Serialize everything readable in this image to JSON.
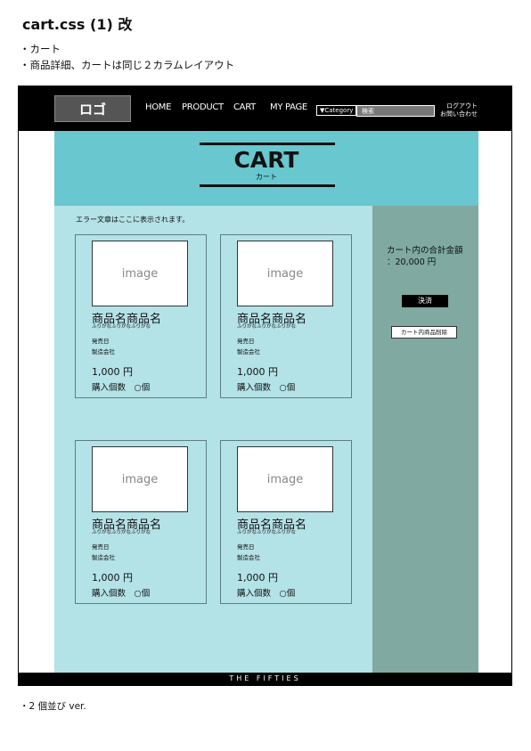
{
  "document": {
    "title": "cart.css (1) 改",
    "notes": [
      "・カート",
      "・商品詳細、カートは同じ２カラムレイアウト"
    ],
    "footnote": "・2 個並び ver."
  },
  "header": {
    "logo": "ロゴ",
    "nav": [
      "HOME",
      "PRODUCT",
      "CART",
      "MY PAGE"
    ],
    "category": "▼Category",
    "search_placeholder": "検索",
    "logout": "ログアウト",
    "contact": "お問い合わせ"
  },
  "hero": {
    "title": "CART",
    "subtitle": "カート"
  },
  "error_message": "エラー文章はここに表示されます。",
  "products": [
    {
      "image": "image",
      "name": "商品名商品名",
      "kana": "ふりがなふりがなふりがな",
      "release": "発売日",
      "maker": "製造会社",
      "price": "1,000 円",
      "qty": "購入個数　○個"
    },
    {
      "image": "image",
      "name": "商品名商品名",
      "kana": "ふりがなふりがなふりがな",
      "release": "発売日",
      "maker": "製造会社",
      "price": "1,000 円",
      "qty": "購入個数　○個"
    },
    {
      "image": "image",
      "name": "商品名商品名",
      "kana": "ふりがなふりがなふりがな",
      "release": "発売日",
      "maker": "製造会社",
      "price": "1,000 円",
      "qty": "購入個数　○個"
    },
    {
      "image": "image",
      "name": "商品名商品名",
      "kana": "ふりがなふりがなふりがな",
      "release": "発売日",
      "maker": "製造会社",
      "price": "1,000 円",
      "qty": "購入個数　○個"
    }
  ],
  "sidebar": {
    "total_label": "カート内の合計金額",
    "total_value": "：20,000 円",
    "pay_button": "決済",
    "clear_button": "カート内商品削除"
  },
  "footer": {
    "text": "THE FIFTIES"
  },
  "colors": {
    "hero": "#68c7cf",
    "content": "#b3e2e7",
    "sidebar": "#7fa9a1",
    "header": "#000000"
  }
}
